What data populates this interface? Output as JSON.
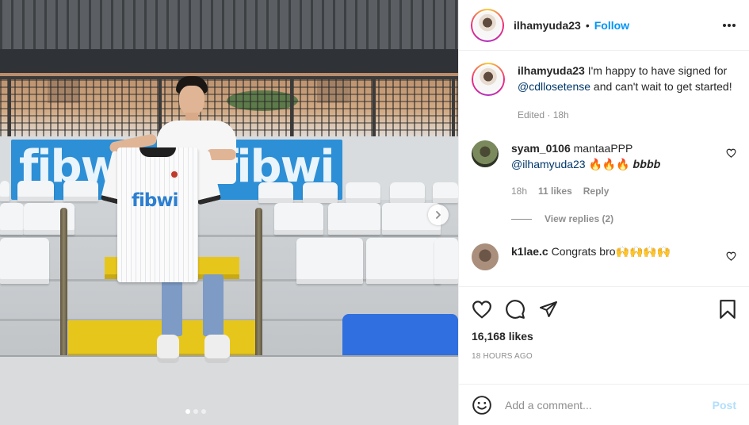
{
  "header": {
    "username": "ilhamyuda23",
    "separator": "•",
    "follow_label": "Follow",
    "more_icon": "more-horizontal-icon"
  },
  "photo": {
    "banner_text": "fibwi",
    "jersey_sponsor": "fibwi",
    "carousel": {
      "total": 3,
      "current": 1
    },
    "next_icon": "chevron-right-icon"
  },
  "caption": {
    "username": "ilhamyuda23",
    "text_before": " I'm happy to have signed for ",
    "mention": "@cdllosetense",
    "text_after": " and can't wait to get started!",
    "edited_label": "Edited · 18h"
  },
  "comments": [
    {
      "username": "syam_0106",
      "text": " mantaaPPP",
      "mention": "@ilhamyuda23",
      "suffix": " 🔥🔥🔥 𝒃𝒃𝒃𝒃",
      "time": "18h",
      "likes": "11 likes",
      "reply_label": "Reply",
      "view_replies": "View replies (2)"
    },
    {
      "username": "k1lae.c",
      "text": " Congrats bro🙌🙌🙌🙌"
    }
  ],
  "actions": {
    "like_icon": "heart-icon",
    "comment_icon": "comment-icon",
    "share_icon": "share-icon",
    "save_icon": "bookmark-icon"
  },
  "likes": "16,168 likes",
  "timestamp": "18 HOURS AGO",
  "add_comment": {
    "emoji_icon": "emoji-icon",
    "placeholder": "Add a comment...",
    "post_label": "Post"
  }
}
